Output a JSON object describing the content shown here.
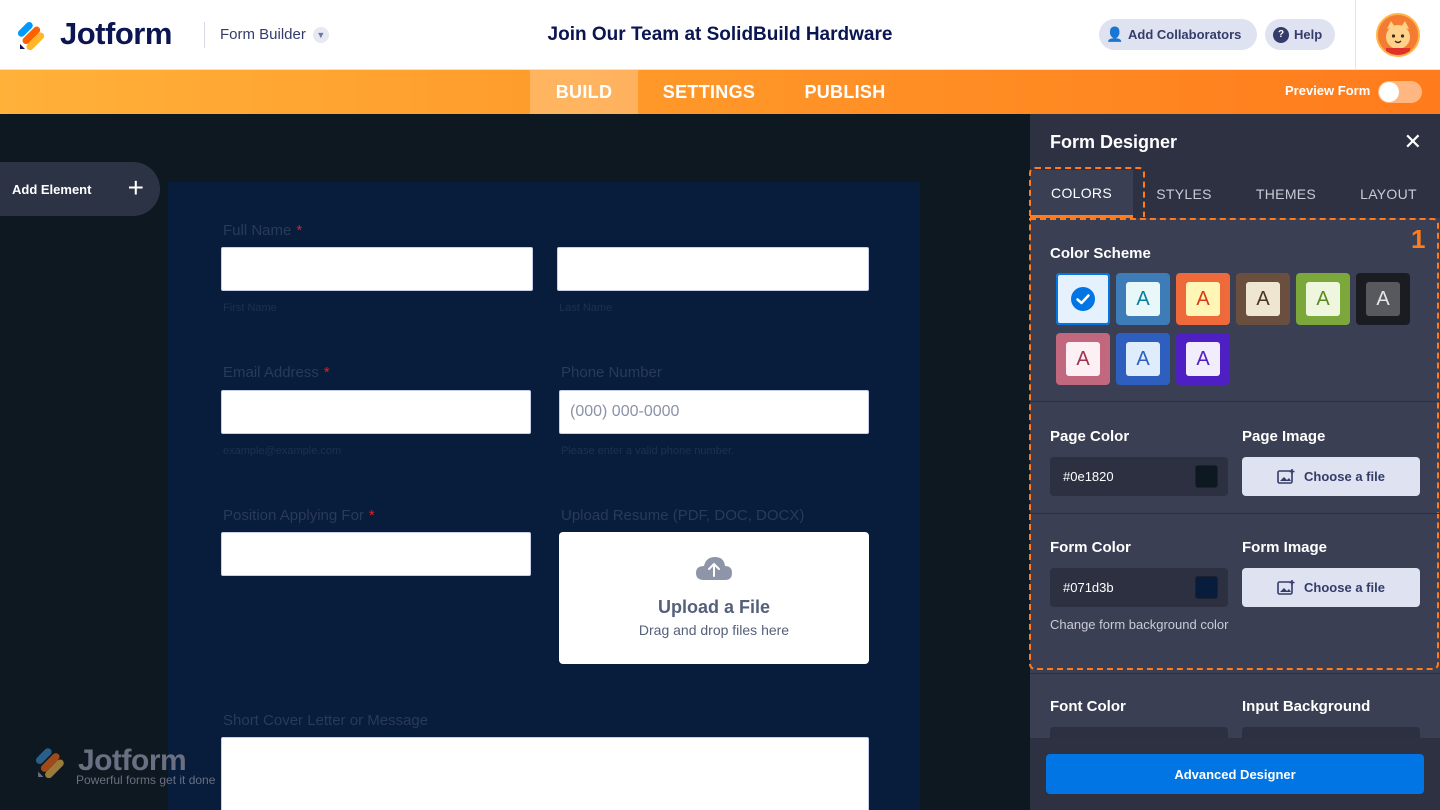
{
  "header": {
    "brand": "Jotform",
    "form_builder_label": "Form Builder",
    "form_title": "Join Our Team at SolidBuild Hardware",
    "collaborators_label": "Add Collaborators",
    "help_label": "Help"
  },
  "nav": {
    "tabs": [
      {
        "label": "BUILD",
        "active": true
      },
      {
        "label": "SETTINGS",
        "active": false
      },
      {
        "label": "PUBLISH",
        "active": false
      }
    ],
    "preview_label": "Preview Form",
    "preview_on": false
  },
  "sidebar": {
    "add_element_label": "Add Element"
  },
  "form": {
    "full_name_label": "Full Name",
    "first_name_sub": "First Name",
    "last_name_sub": "Last Name",
    "email_label": "Email Address",
    "email_sub": "example@example.com",
    "phone_label": "Phone Number",
    "phone_placeholder": "(000) 000-0000",
    "phone_sub": "Please enter a valid phone number.",
    "position_label": "Position Applying For",
    "resume_label": "Upload Resume (PDF, DOC, DOCX)",
    "upload_title": "Upload a File",
    "upload_sub": "Drag and drop files here",
    "cover_label": "Short Cover Letter or Message",
    "required_mark": "*"
  },
  "watermark": {
    "brand": "Jotform",
    "tagline": "Powerful forms get it done"
  },
  "designer": {
    "title": "Form Designer",
    "tabs": [
      {
        "label": "COLORS",
        "active": true
      },
      {
        "label": "STYLES",
        "active": false
      },
      {
        "label": "THEMES",
        "active": false
      },
      {
        "label": "LAYOUT",
        "active": false
      }
    ],
    "highlight_number": "1",
    "color_scheme_title": "Color Scheme",
    "scheme_letter": "A",
    "swatches": [
      {
        "outer": "#e5f1fc",
        "inner": "#0075e3",
        "text": "#ffffff",
        "selected": true
      },
      {
        "outer": "#3e7cb8",
        "inner": "#e8f7f7",
        "text": "#0a7ea0",
        "selected": false
      },
      {
        "outer": "#ef6a3b",
        "inner": "#fff5b5",
        "text": "#d83b15",
        "selected": false
      },
      {
        "outer": "#6b4f3e",
        "inner": "#efe6d2",
        "text": "#4a3527",
        "selected": false
      },
      {
        "outer": "#7ca83b",
        "inner": "#eef7de",
        "text": "#5c8a22",
        "selected": false
      },
      {
        "outer": "#1b1c22",
        "inner": "#58595f",
        "text": "#e6e6e6",
        "selected": false
      },
      {
        "outer": "#c1677e",
        "inner": "#fdf0f4",
        "text": "#a0344f",
        "selected": false
      },
      {
        "outer": "#2e5fbf",
        "inner": "#deecfb",
        "text": "#2e5fbf",
        "selected": false
      },
      {
        "outer": "#4e1fc2",
        "inner": "#f2edfc",
        "text": "#4e1fc2",
        "selected": false
      }
    ],
    "page_color_label": "Page Color",
    "page_color_value": "#0e1820",
    "page_image_label": "Page Image",
    "form_color_label": "Form Color",
    "form_color_value": "#071d3b",
    "form_image_label": "Form Image",
    "choose_file_label": "Choose a file",
    "form_color_hint": "Change form background color",
    "font_color_label": "Font Color",
    "input_bg_label": "Input Background",
    "advanced_label": "Advanced Designer"
  },
  "colors": {
    "accent": "#ff7b1c",
    "primary_button": "#0075e3",
    "page_bg": "#0e1820",
    "form_bg": "#071d3b"
  }
}
